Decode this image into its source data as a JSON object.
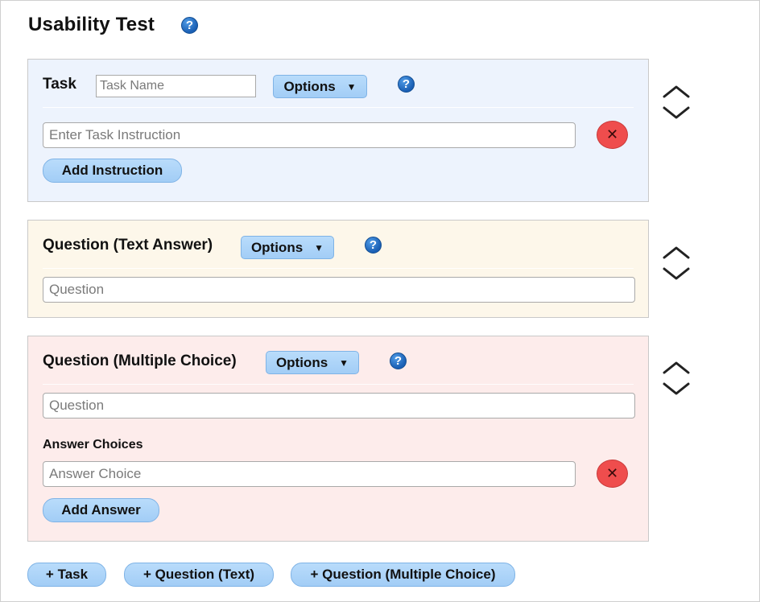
{
  "page": {
    "title": "Usability Test",
    "help_glyph": "?"
  },
  "task": {
    "label": "Task",
    "name_placeholder": "Task Name",
    "options_label": "Options",
    "instruction_placeholder": "Enter Task Instruction",
    "add_instruction_label": "Add Instruction"
  },
  "question_text": {
    "label": "Question (Text Answer)",
    "options_label": "Options",
    "question_placeholder": "Question"
  },
  "question_mc": {
    "label": "Question (Multiple Choice)",
    "options_label": "Options",
    "question_placeholder": "Question",
    "answers_label": "Answer Choices",
    "answer_placeholder": "Answer Choice",
    "add_answer_label": "Add Answer"
  },
  "footer": {
    "add_task_label": "+ Task",
    "add_question_text_label": "+ Question (Text)",
    "add_question_mc_label": "+ Question (Multiple Choice)"
  },
  "icons": {
    "help": "question-circle-icon",
    "caret": "caret-down-icon",
    "remove": "close-circle-icon",
    "move": "chevron-up-down-icon",
    "remove_glyph": "✕",
    "caret_glyph": "▼"
  },
  "colors": {
    "task_bg": "#edf3fd",
    "question_text_bg": "#fdf7ea",
    "question_mc_bg": "#fdeceb",
    "button_bg": "#a2cdf6",
    "help_blue": "#1a5fb4",
    "remove_red": "#ef4d4d"
  }
}
